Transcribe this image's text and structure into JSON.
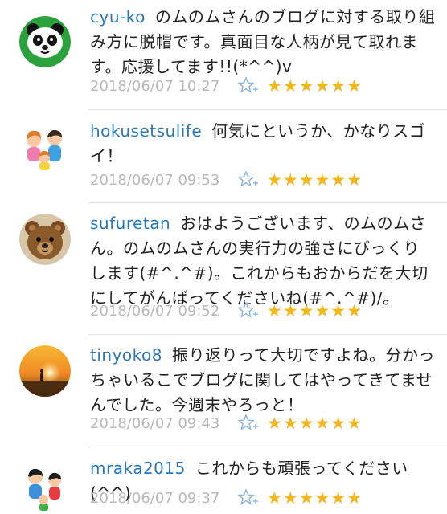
{
  "colors": {
    "username": "#2a78b8",
    "timestamp": "#b9b9b9",
    "star": "#f3b61c",
    "fav_icon": "#8fb6de",
    "divider": "#e3e3e3"
  },
  "comments": [
    {
      "user": "cyu-ko",
      "text": "のムのムさんのブログに対する取り組み方に脱帽です。真面目な人柄が見て取れます。応援してます!!(*^^)v",
      "time": "2018/06/07 10:27",
      "stars": "★★★★★★",
      "star_count": 6,
      "avatar": "panda-avatar-icon"
    },
    {
      "user": "hokusetsulife",
      "text": "何気にというか、かなりスゴイ！",
      "time": "2018/06/07 09:53",
      "stars": "★★★★★★",
      "star_count": 6,
      "avatar": "family-avatar-icon"
    },
    {
      "user": "sufuretan",
      "text": "おはようございます、のムのムさん。のムのムさんの実行力の強さにびっくりします(#^.^#)。これからもおからだを大切にしてがんばってくださいね(#^.^#)/。",
      "time": "2018/06/07 09:52",
      "stars": "★★★★★★",
      "star_count": 6,
      "avatar": "teddy-bear-avatar-icon"
    },
    {
      "user": "tinyoko8",
      "text": "振り返りって大切ですよね。分かっちゃいるこでブログに関してはやってきてませんでした。今週末やろっと！",
      "time": "2018/06/07 09:43",
      "stars": "★★★★★★",
      "star_count": 6,
      "avatar": "sunset-avatar-icon"
    },
    {
      "user": "mraka2015",
      "text": "これからも頑張ってください(^^)",
      "time": "2018/06/07 09:37",
      "stars": "★★★★★★",
      "star_count": 6,
      "avatar": "people-avatar-icon"
    }
  ]
}
